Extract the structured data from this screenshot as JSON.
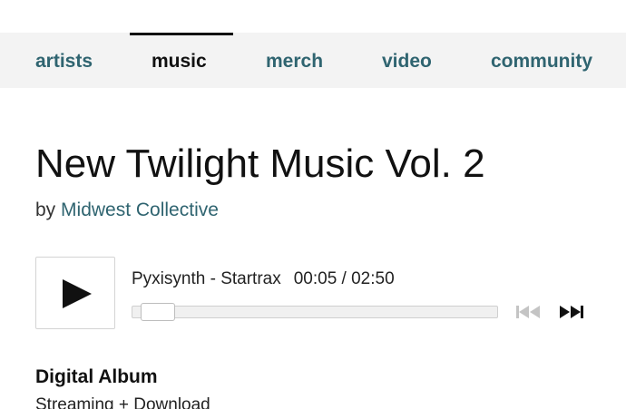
{
  "nav": {
    "tabs": [
      {
        "label": "artists",
        "active": false
      },
      {
        "label": "music",
        "active": true
      },
      {
        "label": "merch",
        "active": false
      },
      {
        "label": "video",
        "active": false
      },
      {
        "label": "community",
        "active": false
      }
    ]
  },
  "album": {
    "title": "New Twilight Music Vol. 2",
    "by_prefix": "by",
    "artist": "Midwest Collective"
  },
  "player": {
    "track": "Pyxisynth - Startrax",
    "time": "00:05 / 02:50",
    "progress_fraction": 0.03,
    "icons": {
      "play": "play-icon",
      "previous": "previous-track-icon",
      "next": "next-track-icon"
    }
  },
  "purchase": {
    "format": "Digital Album",
    "subtitle": "Streaming + Download"
  },
  "colors": {
    "link": "#2f6470",
    "nav_background": "#f3f3f3",
    "active_tab": "#111111",
    "disabled_control": "#c4c4c4"
  }
}
